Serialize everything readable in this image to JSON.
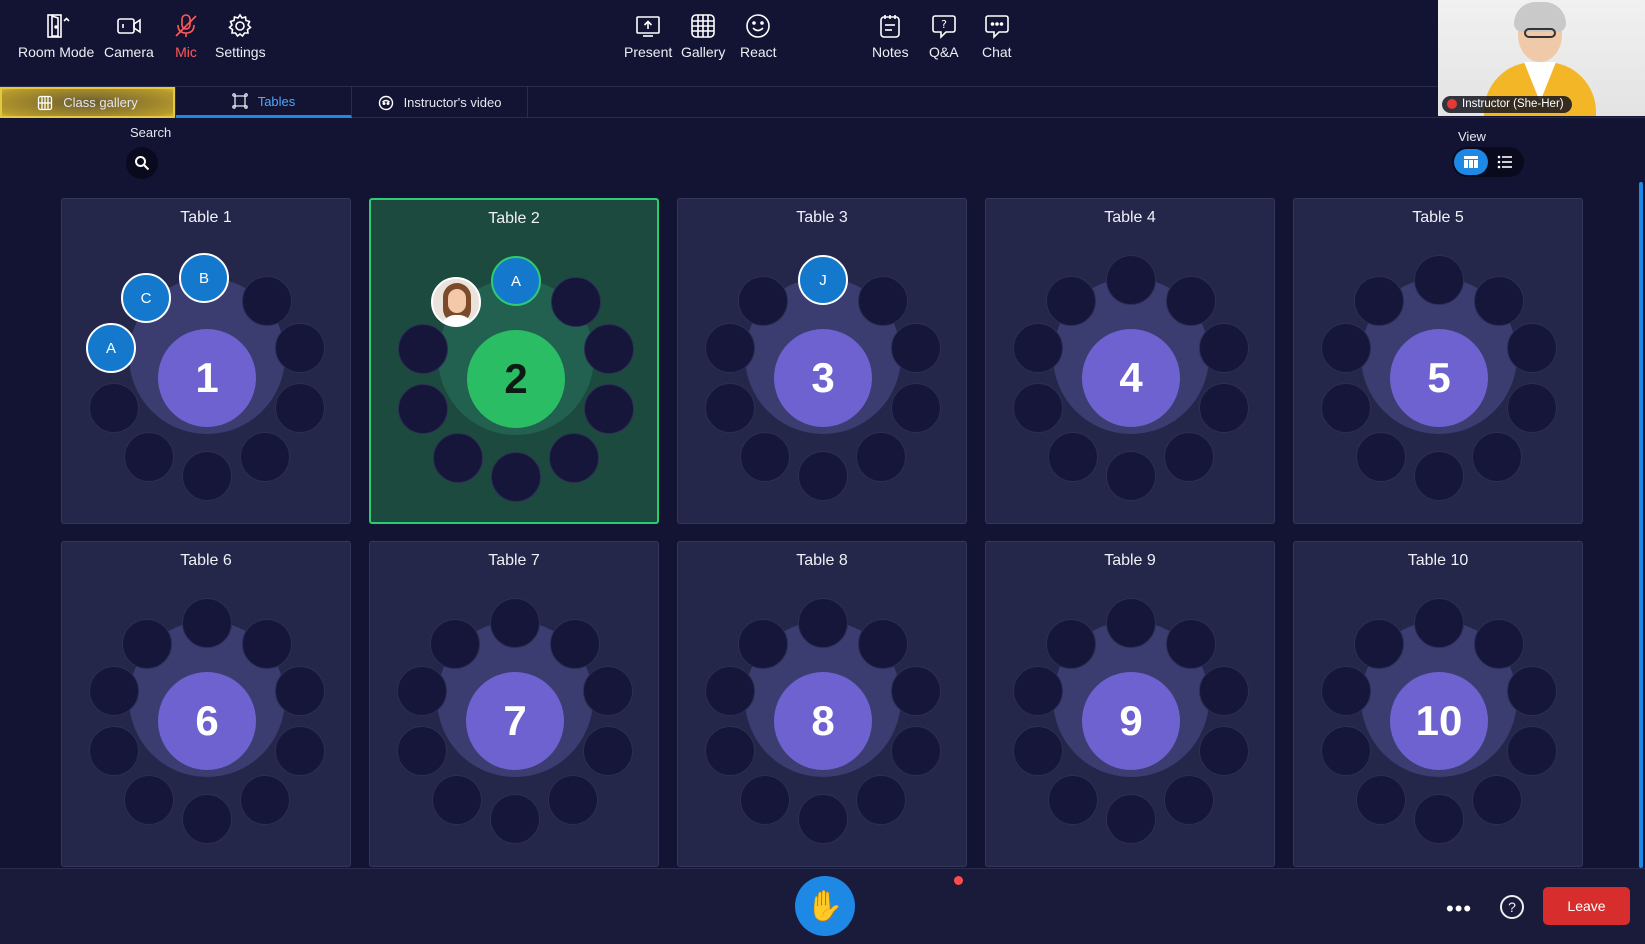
{
  "tabs": [
    {
      "label": "Class gallery",
      "icon": "grid-globe-icon",
      "state": "highlighted"
    },
    {
      "label": "Tables",
      "icon": "tables-icon",
      "state": "active"
    },
    {
      "label": "Instructor's video",
      "icon": "webcam-icon",
      "state": "normal"
    }
  ],
  "instructor": {
    "label": "Instructor (She-Her)"
  },
  "search": {
    "label": "Search"
  },
  "view": {
    "label": "View",
    "options": [
      "grid-view-icon",
      "list-view-icon"
    ],
    "selected": "grid-view-icon"
  },
  "tables": [
    {
      "title": "Table 1",
      "number": "1",
      "selected": false
    },
    {
      "title": "Table 2",
      "number": "2",
      "selected": true
    },
    {
      "title": "Table 3",
      "number": "3",
      "selected": false
    },
    {
      "title": "Table 4",
      "number": "4",
      "selected": false
    },
    {
      "title": "Table 5",
      "number": "5",
      "selected": false
    },
    {
      "title": "Table 6",
      "number": "6",
      "selected": false
    },
    {
      "title": "Table 7",
      "number": "7",
      "selected": false
    },
    {
      "title": "Table 8",
      "number": "8",
      "selected": false
    },
    {
      "title": "Table 9",
      "number": "9",
      "selected": false
    },
    {
      "title": "Table 10",
      "number": "10",
      "selected": false
    }
  ],
  "participants": {
    "t1_a": "A",
    "t1_b": "B",
    "t1_c": "C",
    "t2_a": "A",
    "t3_j": "J"
  },
  "toolbar": {
    "room_mode": "Room Mode",
    "camera": "Camera",
    "mic": "Mic",
    "settings": "Settings",
    "present": "Present",
    "gallery": "Gallery",
    "react": "React",
    "notes": "Notes",
    "qa": "Q&A",
    "chat": "Chat",
    "more": "•••",
    "help": "?",
    "leave": "Leave"
  },
  "colors": {
    "background": "#131433",
    "accent": "#1e88e5",
    "table_center": "#6e62d0",
    "selected_table": "#2bbd63",
    "leave": "#d72d2d"
  }
}
